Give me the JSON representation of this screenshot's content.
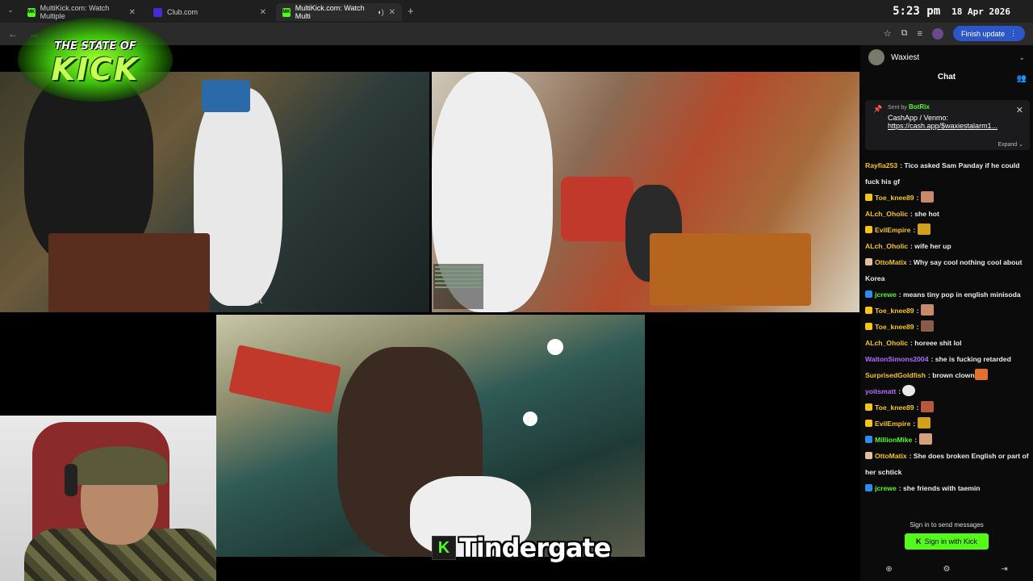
{
  "browser": {
    "tabs": [
      {
        "label": "MultiKick.com: Watch Multiple",
        "favicon": "MK",
        "favicon_color": "#53fc18"
      },
      {
        "label": "Club.com",
        "favicon": "",
        "favicon_color": "#4b2ad6"
      },
      {
        "label": "MultiKick.com: Watch Multi",
        "favicon": "MK",
        "favicon_color": "#53fc18"
      }
    ],
    "clock_time": "5:23 pm",
    "clock_date": "18 Apr 2026",
    "finish_update_label": "Finish update"
  },
  "logo": {
    "top_text": "THE STATE OF",
    "main_text": "KICK",
    "color": "#53fc18"
  },
  "video": {
    "watermark": "Waxiest"
  },
  "caption": {
    "badge": "K",
    "text": "Tindergate"
  },
  "chat": {
    "channel_name": "Waxiest",
    "title": "Chat",
    "pinned": {
      "sent_by": "Sent by",
      "bot_name": "BotRix",
      "line1": "CashApp / Venmo:",
      "link": "https://cash.app/$waxiestalarm1...",
      "expand": "Expand"
    },
    "messages": [
      {
        "user": "Rayfia253",
        "color": "#f5c518",
        "text": "Tico asked Sam Panday if he could fuck his gf",
        "badge": "",
        "emote": ""
      },
      {
        "user": "Toe_knee89",
        "color": "#f5c518",
        "text": "",
        "badge": "sub",
        "emote": "face"
      },
      {
        "user": "ALch_Oholic",
        "color": "#f5c518",
        "text": "she hot",
        "badge": "",
        "emote": ""
      },
      {
        "user": "EvilEmpire",
        "color": "#f5c518",
        "text": "",
        "badge": "sub",
        "emote": "gold"
      },
      {
        "user": "ALch_Oholic",
        "color": "#f5c518",
        "text": "wife her up",
        "badge": "",
        "emote": ""
      },
      {
        "user": "OttoMatix",
        "color": "#f5c518",
        "text": "Why say cool nothing cool about Korea",
        "badge": "mic",
        "emote": ""
      },
      {
        "user": "jcrewe",
        "color": "#53fc18",
        "text": "means tiny pop in english minisoda",
        "badge": "blue",
        "emote": ""
      },
      {
        "user": "Toe_knee89",
        "color": "#f5c518",
        "text": "",
        "badge": "sub",
        "emote": "face"
      },
      {
        "user": "Toe_knee89",
        "color": "#f5c518",
        "text": "",
        "badge": "sub",
        "emote": "face2"
      },
      {
        "user": "ALch_Oholic",
        "color": "#f5c518",
        "text": "horeee shit lol",
        "badge": "",
        "emote": ""
      },
      {
        "user": "WaltonSimons2004",
        "color": "#b36bff",
        "text": "she is fucking retarded",
        "badge": "",
        "emote": ""
      },
      {
        "user": "SurprisedGoldfish",
        "color": "#f5c518",
        "text": "brown clown",
        "badge": "",
        "emote": "clown"
      },
      {
        "user": "yoitsmatt",
        "color": "#b36bff",
        "text": "",
        "badge": "",
        "emote": "skull"
      },
      {
        "user": "Toe_knee89",
        "color": "#f5c518",
        "text": "",
        "badge": "sub",
        "emote": "face3"
      },
      {
        "user": "EvilEmpire",
        "color": "#f5c518",
        "text": "",
        "badge": "sub",
        "emote": "gold"
      },
      {
        "user": "MillionMike",
        "color": "#53fc18",
        "text": "",
        "badge": "blue",
        "emote": "face4"
      },
      {
        "user": "OttoMatix",
        "color": "#f5c518",
        "text": "She does broken English or part of her schtick",
        "badge": "mic",
        "emote": ""
      },
      {
        "user": "jcrewe",
        "color": "#53fc18",
        "text": "she friends with taemin",
        "badge": "blue",
        "emote": ""
      }
    ],
    "sign_in_note": "Sign in to send messages",
    "sign_in_button": "Sign in with Kick"
  }
}
